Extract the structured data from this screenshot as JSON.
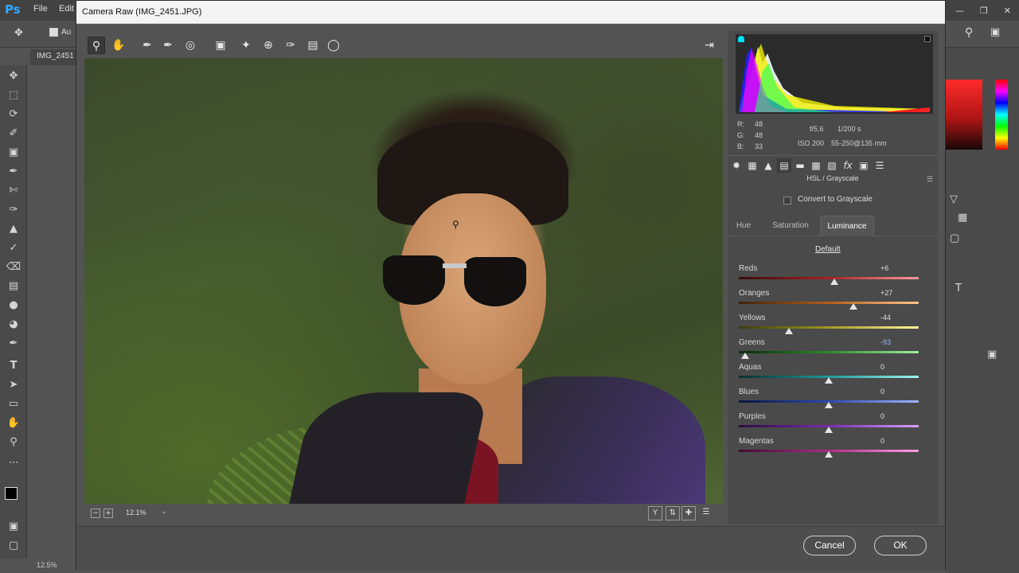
{
  "photoshop": {
    "logo": "Ps",
    "menus": [
      "File",
      "Edit"
    ],
    "doc_tab": "IMG_2451",
    "status_zoom": "12.5%",
    "options_auto_label": "Au"
  },
  "dialog": {
    "title": "Camera Raw (IMG_2451.JPG)",
    "zoom_level": "12.1%",
    "cancel_label": "Cancel",
    "ok_label": "OK"
  },
  "readout": {
    "r_label": "R:",
    "r_value": "48",
    "g_label": "G:",
    "g_value": "48",
    "b_label": "B:",
    "b_value": "33",
    "aperture": "f/5.6",
    "shutter": "1/200 s",
    "iso": "ISO 200",
    "lens": "55-250@135 mm"
  },
  "panel": {
    "header": "HSL / Grayscale",
    "grayscale_label": "Convert to Grayscale",
    "tabs": [
      {
        "label": "Hue"
      },
      {
        "label": "Saturation"
      },
      {
        "label": "Luminance"
      }
    ],
    "default_label": "Default",
    "sliders": [
      {
        "label": "Reds",
        "value": "+6",
        "amount": 6,
        "gradient": "linear-gradient(to right,#3a0c0c,#a52020,#ff9b9b)"
      },
      {
        "label": "Oranges",
        "value": "+27",
        "amount": 27,
        "gradient": "linear-gradient(to right,#3f2008,#b35f1a,#ffc38a)"
      },
      {
        "label": "Yellows",
        "value": "-44",
        "amount": -44,
        "gradient": "linear-gradient(to right,#3c3a0a,#a09a20,#fff79a)"
      },
      {
        "label": "Greens",
        "value": "-93",
        "amount": -93,
        "gradient": "linear-gradient(to right,#0c2c0c,#2b8a2b,#9fef9f)"
      },
      {
        "label": "Aquas",
        "value": "0",
        "amount": 0,
        "gradient": "linear-gradient(to right,#0a2f30,#1f9a9c,#9ff3f3)"
      },
      {
        "label": "Blues",
        "value": "0",
        "amount": 0,
        "gradient": "linear-gradient(to right,#0c1540,#2a48b0,#9fb4ff)"
      },
      {
        "label": "Purples",
        "value": "0",
        "amount": 0,
        "gradient": "linear-gradient(to right,#2c0c40,#7a2ab0,#d7a0ff)"
      },
      {
        "label": "Magentas",
        "value": "0",
        "amount": 0,
        "gradient": "linear-gradient(to right,#400c30,#b02a88,#ffa0e4)"
      }
    ]
  },
  "colors": {
    "accent_blue": "#31a8ff",
    "histogram_bg": "#2b2b2b"
  }
}
